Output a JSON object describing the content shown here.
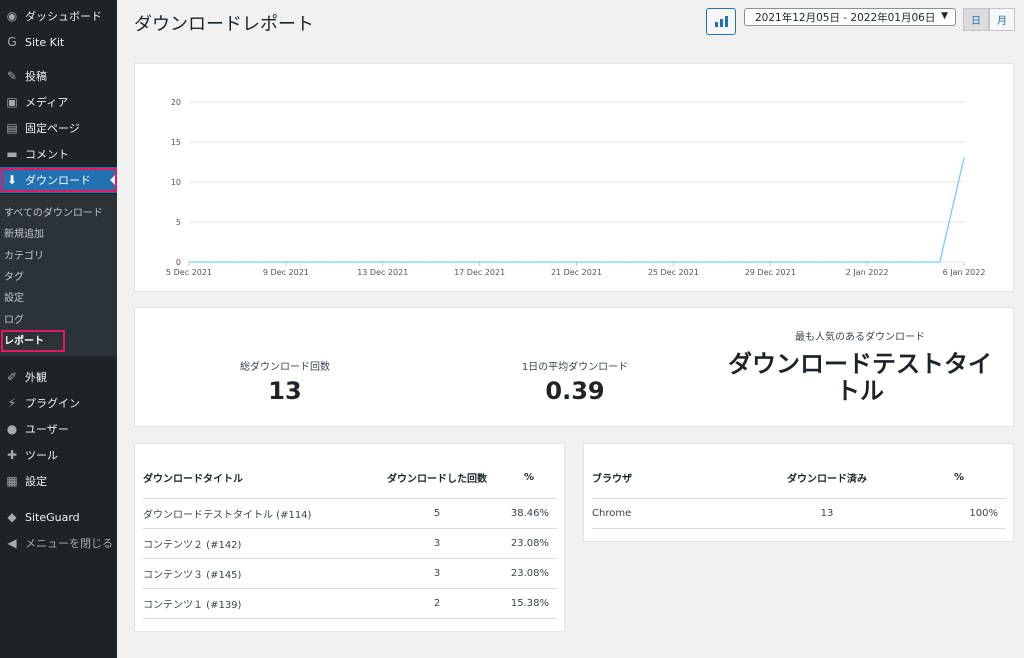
{
  "sidebar": {
    "items": [
      {
        "icon": "dashboard-icon",
        "glyph": "◉",
        "label": "ダッシュボード"
      },
      {
        "icon": "google-icon",
        "glyph": "G",
        "label": "Site Kit"
      },
      {
        "icon": "pin-icon",
        "glyph": "✎",
        "label": "投稿"
      },
      {
        "icon": "media-icon",
        "glyph": "▣",
        "label": "メディア"
      },
      {
        "icon": "page-icon",
        "glyph": "▤",
        "label": "固定ページ"
      },
      {
        "icon": "comment-icon",
        "glyph": "▬",
        "label": "コメント"
      },
      {
        "icon": "download-icon",
        "glyph": "⬇",
        "label": "ダウンロード"
      },
      {
        "icon": "appearance-icon",
        "glyph": "✐",
        "label": "外観"
      },
      {
        "icon": "plugin-icon",
        "glyph": "⚡",
        "label": "プラグイン"
      },
      {
        "icon": "user-icon",
        "glyph": "●",
        "label": "ユーザー"
      },
      {
        "icon": "tool-icon",
        "glyph": "✚",
        "label": "ツール"
      },
      {
        "icon": "settings-icon",
        "glyph": "▦",
        "label": "設定"
      },
      {
        "icon": "siteguard-icon",
        "glyph": "◆",
        "label": "SiteGuard"
      },
      {
        "icon": "collapse-icon",
        "glyph": "◀",
        "label": "メニューを閉じる"
      }
    ],
    "submenu": [
      "すべてのダウンロード",
      "新規追加",
      "カテゴリ",
      "タグ",
      "設定",
      "ログ",
      "レポート"
    ]
  },
  "header": {
    "title": "ダウンロードレポート",
    "date_range": "2021年12月05日 - 2022年01月06日",
    "date_arrow": "▼",
    "period_day": "日",
    "period_month": "月"
  },
  "chart_data": {
    "type": "line",
    "x_ticks": [
      "5 Dec 2021",
      "9 Dec 2021",
      "13 Dec 2021",
      "17 Dec 2021",
      "21 Dec 2021",
      "25 Dec 2021",
      "29 Dec 2021",
      "2 Jan 2022",
      "6 Jan 2022"
    ],
    "y_ticks": [
      0,
      5,
      10,
      15,
      20
    ],
    "ylim": [
      0,
      20
    ],
    "x": [
      "5 Dec 2021",
      "6 Dec 2021",
      "7 Dec 2021",
      "8 Dec 2021",
      "9 Dec 2021",
      "10 Dec 2021",
      "11 Dec 2021",
      "12 Dec 2021",
      "13 Dec 2021",
      "14 Dec 2021",
      "15 Dec 2021",
      "16 Dec 2021",
      "17 Dec 2021",
      "18 Dec 2021",
      "19 Dec 2021",
      "20 Dec 2021",
      "21 Dec 2021",
      "22 Dec 2021",
      "23 Dec 2021",
      "24 Dec 2021",
      "25 Dec 2021",
      "26 Dec 2021",
      "27 Dec 2021",
      "28 Dec 2021",
      "29 Dec 2021",
      "30 Dec 2021",
      "31 Dec 2021",
      "1 Jan 2022",
      "2 Jan 2022",
      "3 Jan 2022",
      "4 Jan 2022",
      "5 Jan 2022",
      "6 Jan 2022"
    ],
    "values": [
      0,
      0,
      0,
      0,
      0,
      0,
      0,
      0,
      0,
      0,
      0,
      0,
      0,
      0,
      0,
      0,
      0,
      0,
      0,
      0,
      0,
      0,
      0,
      0,
      0,
      0,
      0,
      0,
      0,
      0,
      0,
      0,
      13
    ],
    "grid": true,
    "line_color": "#72d0f4"
  },
  "stats": {
    "total_label": "総ダウンロード回数",
    "total_value": "13",
    "avg_label": "1日の平均ダウンロード",
    "avg_value": "0.39",
    "popular_label": "最も人気のあるダウンロード",
    "popular_value": "ダウンロードテストタイトル"
  },
  "downloads_table": {
    "headers": [
      "ダウンロードタイトル",
      "ダウンロードした回数",
      "%"
    ],
    "rows": [
      [
        "ダウンロードテストタイトル (#114)",
        "5",
        "38.46%"
      ],
      [
        "コンテンツ２ (#142)",
        "3",
        "23.08%"
      ],
      [
        "コンテンツ３ (#145)",
        "3",
        "23.08%"
      ],
      [
        "コンテンツ１ (#139)",
        "2",
        "15.38%"
      ]
    ]
  },
  "browser_table": {
    "headers": [
      "ブラウザ",
      "ダウンロード済み",
      "%"
    ],
    "rows": [
      [
        "Chrome",
        "13",
        "100%"
      ]
    ]
  }
}
